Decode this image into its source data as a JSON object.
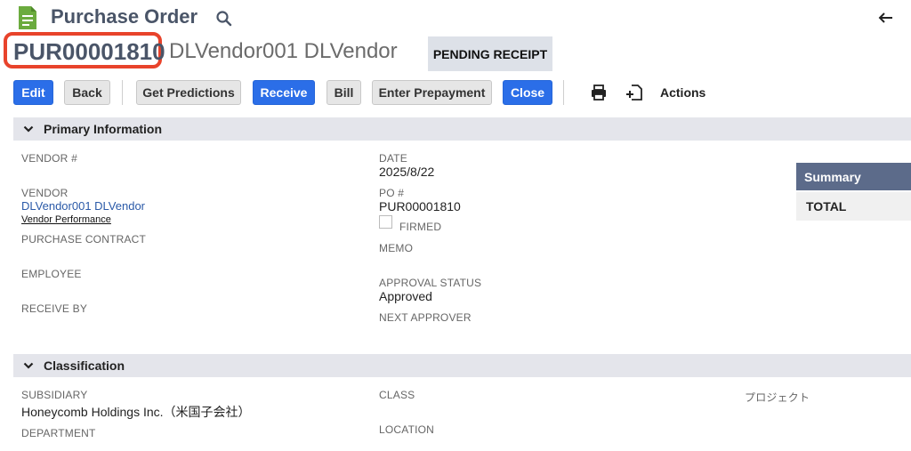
{
  "header": {
    "title": "Purchase Order",
    "record_number": "PUR00001810",
    "vendor_heading": "DLVendor001 DLVendor",
    "status_badge": "PENDING RECEIPT"
  },
  "toolbar": {
    "buttons": [
      {
        "label": "Edit",
        "style": "primary"
      },
      {
        "label": "Back",
        "style": "secondary"
      },
      {
        "label": "Get Predictions",
        "style": "secondary"
      },
      {
        "label": "Receive",
        "style": "primary"
      },
      {
        "label": "Bill",
        "style": "secondary"
      },
      {
        "label": "Enter Prepayment",
        "style": "secondary"
      },
      {
        "label": "Close",
        "style": "primary"
      }
    ],
    "icons": [
      "print-icon",
      "add-document-icon"
    ],
    "actions_label": "Actions"
  },
  "primary_info": {
    "title": "Primary Information",
    "vendor_num_label": "VENDOR #",
    "vendor_label": "VENDOR",
    "vendor_value": "DLVendor001 DLVendor",
    "vendor_performance": "Vendor Performance",
    "purchase_contract_label": "PURCHASE CONTRACT",
    "employee_label": "EMPLOYEE",
    "receive_by_label": "RECEIVE BY",
    "date_label": "DATE",
    "date_value": "2025/8/22",
    "po_label": "PO #",
    "po_value": "PUR00001810",
    "firmed_label": "FIRMED",
    "memo_label": "MEMO",
    "approval_status_label": "APPROVAL STATUS",
    "approval_status_value": "Approved",
    "next_approver_label": "NEXT APPROVER"
  },
  "summary": {
    "title": "Summary",
    "total_label": "TOTAL"
  },
  "classification": {
    "title": "Classification",
    "subsidiary_label": "SUBSIDIARY",
    "subsidiary_value": "Honeycomb Holdings Inc.（米国子会社）",
    "department_label": "DEPARTMENT",
    "class_label": "CLASS",
    "location_label": "LOCATION",
    "project_label": "プロジェクト"
  },
  "colors": {
    "primary_button": "#2b6ee8",
    "highlight_border": "#e8432b",
    "summary_header": "#5c6b8a",
    "section_bar": "#e4e5eb"
  }
}
